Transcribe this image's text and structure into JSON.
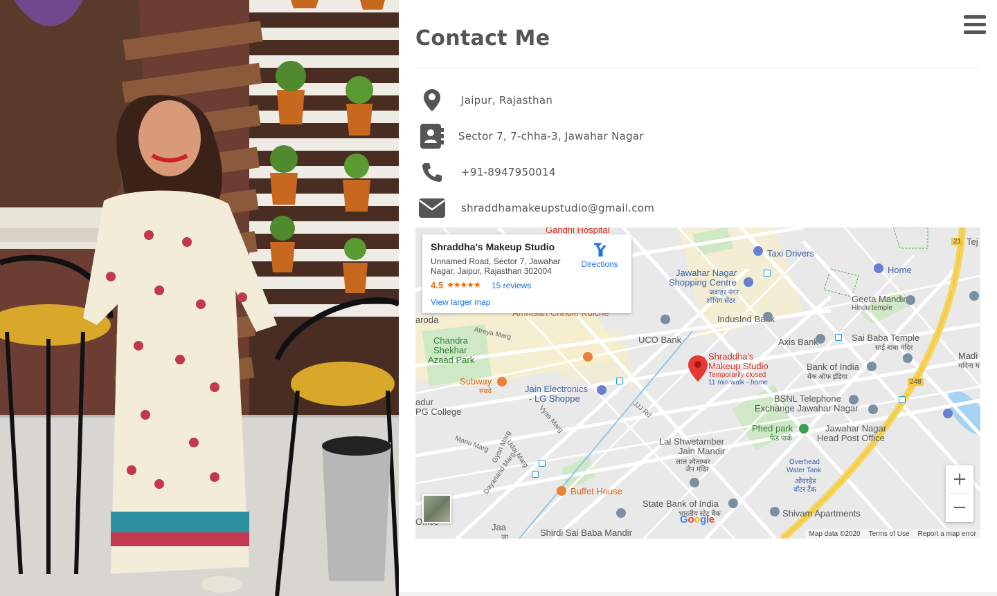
{
  "page": {
    "title": "Contact Me"
  },
  "contact": {
    "location": "Jaipur, Rajasthan",
    "address": "Sector 7, 7-chha-3, Jawahar Nagar",
    "phone": "+91-8947950014",
    "email": "shraddhamakeupstudio@gmail.com"
  },
  "icons": {
    "menu": "hamburger-icon",
    "location": "map-marker-icon",
    "address": "address-book-icon",
    "phone": "phone-icon",
    "email": "envelope-icon"
  },
  "map": {
    "card": {
      "name": "Shraddha's Makeup Studio",
      "address": "Unnamed Road, Sector 7, Jawahar Nagar, Jaipur, Rajasthan 302004",
      "rating": "4.5",
      "stars": "★★★★★",
      "reviews": "15 reviews",
      "larger_map": "View larger map",
      "directions": "Directions"
    },
    "marker": {
      "name_line1": "Shraddha's",
      "name_line2": "Makeup Studio",
      "status": "Temporarily closed",
      "walk": "11 min walk - home"
    },
    "labels": {
      "gandhi_hospital": "Gandhi Hospital",
      "taxi_drivers": "Taxi Drivers",
      "tej": "Tej",
      "home": "Home",
      "jawahar_nagar_sc1": "Jawahar Nagar",
      "jawahar_nagar_sc2": "Shopping Centre",
      "jawahar_nagar_hi1": "जवाहर नगर",
      "jawahar_nagar_hi2": "शॉपिंग सेंटर",
      "geeta_mandir": "Geeta Mandir",
      "hindu_temple": "Hindu temple",
      "indusind": "IndusInd Bank",
      "aroda": "aroda",
      "amritsari": "Amritsari Chhole Kulche",
      "atreya_marg": "Atreya Marg",
      "uco": "UCO Bank",
      "axis": "Axis Bank",
      "sai_baba": "Sai Baba Temple",
      "sai_baba_hi": "साईं बाबा मंदिर",
      "chandra1": "Chandra",
      "chandra2": "Shekhar",
      "chandra3": "Azaad Park",
      "madi": "Madi",
      "madina_hi": "मदिना म",
      "bank_of_india": "Bank of India",
      "bank_of_india_hi": "बैंक ऑफ इंडिया",
      "subway": "Subway",
      "subway_hi": "सबवे",
      "jain_electronics1": "Jain Electronics",
      "jain_electronics2": "- LG Shoppe",
      "jjj_rd": "JJJ Rd",
      "r248": "248",
      "r21": "21",
      "adur": "adur",
      "pg_college": "PG College",
      "bsnl1": "BSNL Telephone",
      "bsnl2": "Exchange Jawahar Nagar",
      "vyas_marg": "Vyas Marg",
      "manu_marg": "Manu Marg",
      "phed_park": "Phed park",
      "phed_park_hi": "फेड पार्क",
      "jn_hpo1": "Jawahar Nagar",
      "jn_hpo2": "Head Post Office",
      "udai_marg": "Udai Marg",
      "gyan_marg": "Gyan Marg",
      "lal_shwetamber1": "Lal Shwetamber",
      "lal_shwetamber2": "Jain Mandir",
      "lal_hi1": "लाल श्वेताम्बर",
      "lal_hi2": "जैन मंदिर",
      "overhead1": "Overhead",
      "overhead2": "Water Tank",
      "overhead_hi1": "ओवरहेड",
      "overhead_hi2": "वॉटर टैंक",
      "dayanand_marg": "Dayanand Marg",
      "buffet_house": "Buffet House",
      "sbi": "State Bank of India",
      "sbi_hi": "भारतीय स्टेट बैंक",
      "shivam": "Shivam Apartments",
      "office": "Office",
      "jaa": "Jaa",
      "jaa_hi": "जा",
      "shirdi": "Shirdi Sai Baba Mandir"
    },
    "google_logo": "Google",
    "attribution": {
      "data": "Map data ©2020",
      "terms": "Terms of Use",
      "report": "Report a map error"
    },
    "zoom_in": "+",
    "zoom_out": "−"
  }
}
